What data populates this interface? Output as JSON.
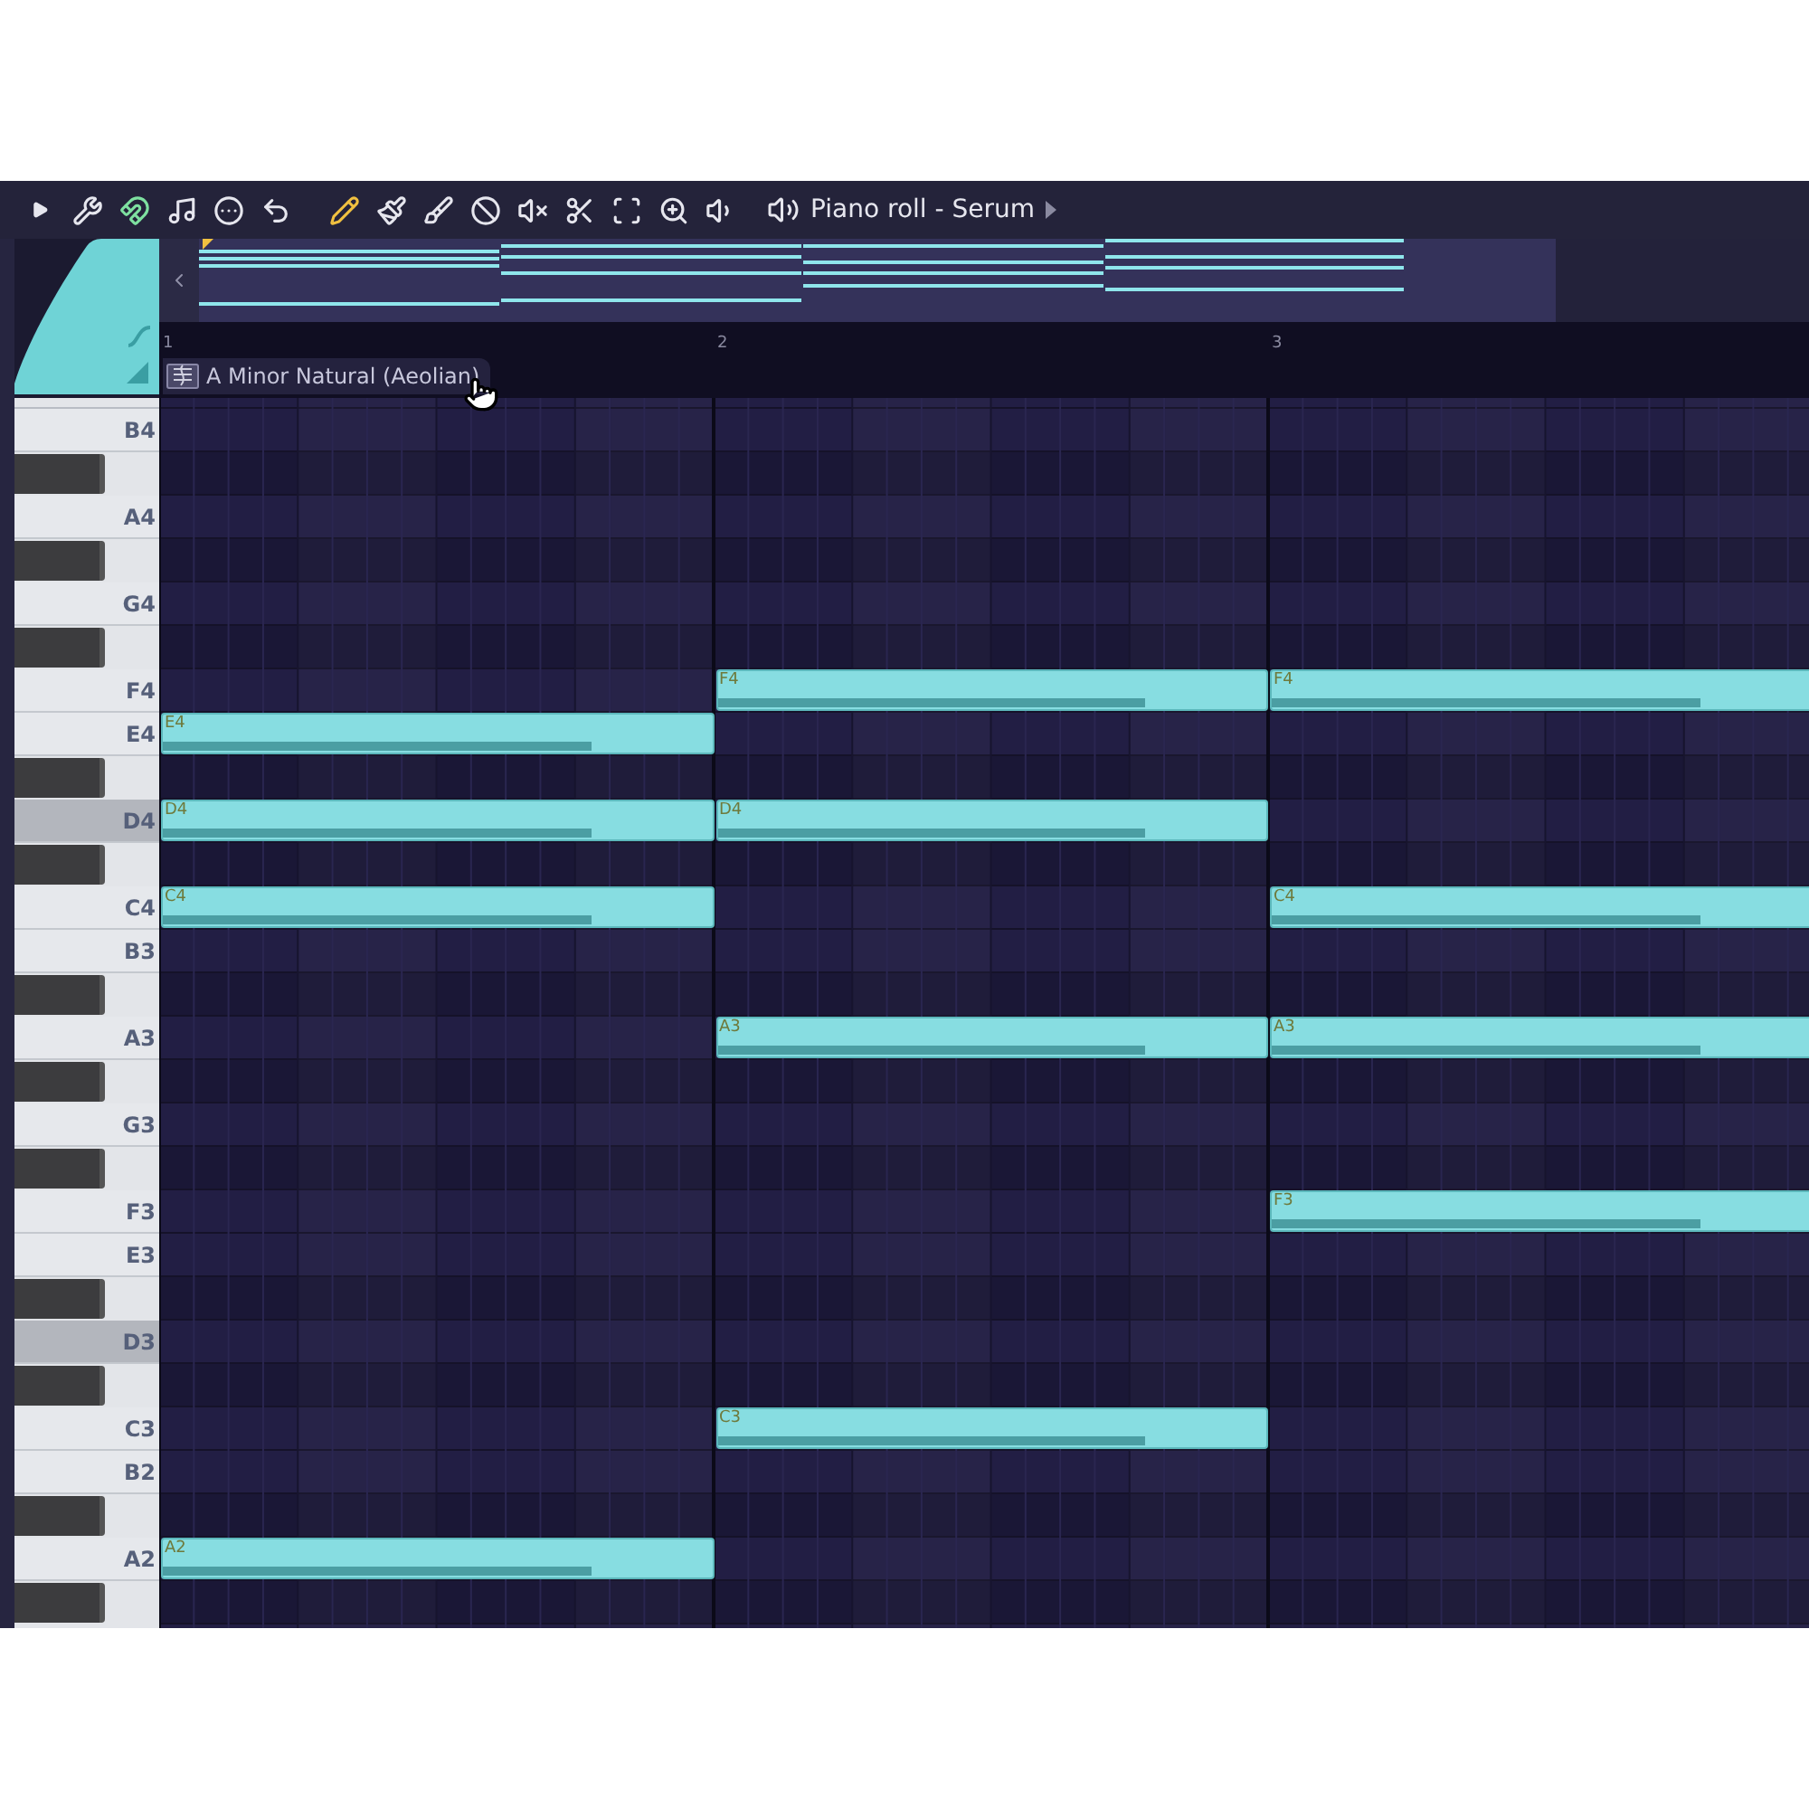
{
  "toolbar": {
    "tools": [
      {
        "kind": "play",
        "active": false
      },
      {
        "kind": "wrench",
        "active": false
      },
      {
        "kind": "magnet",
        "active": true
      },
      {
        "kind": "note",
        "active": false
      },
      {
        "kind": "menu",
        "active": false
      },
      {
        "kind": "undo",
        "active": false
      },
      {
        "kind": "pencil",
        "active": true
      },
      {
        "kind": "brush",
        "active": false
      },
      {
        "kind": "brush-plus",
        "active": false
      },
      {
        "kind": "ban",
        "active": false
      },
      {
        "kind": "mute",
        "active": false
      },
      {
        "kind": "slice",
        "active": false
      },
      {
        "kind": "select",
        "active": false
      },
      {
        "kind": "zoom",
        "active": false
      },
      {
        "kind": "playback",
        "active": false
      }
    ],
    "title": "Piano roll - Serum"
  },
  "ruler": {
    "bars": [
      {
        "label": "1"
      },
      {
        "label": "2"
      },
      {
        "label": "3"
      }
    ],
    "scale": "A Minor Natural (Aeolian)"
  },
  "keys": [
    {
      "kind": "white",
      "label": "B4",
      "highlighted": false
    },
    {
      "kind": "black",
      "highlighted": false
    },
    {
      "kind": "white",
      "label": "A4",
      "highlighted": false
    },
    {
      "kind": "black",
      "highlighted": false
    },
    {
      "kind": "white",
      "label": "G4",
      "highlighted": false
    },
    {
      "kind": "black",
      "highlighted": false
    },
    {
      "kind": "white",
      "label": "F4",
      "highlighted": false,
      "slots": [
        {
          "kind": "empty"
        },
        {
          "kind": "note",
          "label": "F4",
          "level": 0.78
        },
        {
          "kind": "note",
          "label": "F4",
          "level": 0.78
        }
      ]
    },
    {
      "kind": "white",
      "label": "E4",
      "highlighted": false,
      "slots": [
        {
          "kind": "note",
          "label": "E4",
          "level": 0.78
        }
      ]
    },
    {
      "kind": "black",
      "highlighted": false
    },
    {
      "kind": "white",
      "label": "D4",
      "highlighted": true,
      "slots": [
        {
          "kind": "note",
          "label": "D4",
          "level": 0.78
        },
        {
          "kind": "note",
          "label": "D4",
          "level": 0.78
        }
      ]
    },
    {
      "kind": "black",
      "highlighted": false
    },
    {
      "kind": "white",
      "label": "C4",
      "highlighted": false,
      "slots": [
        {
          "kind": "note",
          "label": "C4",
          "level": 0.78
        },
        {
          "kind": "empty"
        },
        {
          "kind": "note",
          "label": "C4",
          "level": 0.78
        }
      ]
    },
    {
      "kind": "white",
      "label": "B3",
      "highlighted": false
    },
    {
      "kind": "black",
      "highlighted": false
    },
    {
      "kind": "white",
      "label": "A3",
      "highlighted": false,
      "slots": [
        {
          "kind": "empty"
        },
        {
          "kind": "note",
          "label": "A3",
          "level": 0.78
        },
        {
          "kind": "note",
          "label": "A3",
          "level": 0.78
        }
      ]
    },
    {
      "kind": "black",
      "highlighted": false
    },
    {
      "kind": "white",
      "label": "G3",
      "highlighted": false
    },
    {
      "kind": "black",
      "highlighted": false
    },
    {
      "kind": "white",
      "label": "F3",
      "highlighted": false,
      "slots": [
        {
          "kind": "empty"
        },
        {
          "kind": "empty"
        },
        {
          "kind": "note",
          "label": "F3",
          "level": 0.78
        }
      ]
    },
    {
      "kind": "white",
      "label": "E3",
      "highlighted": false
    },
    {
      "kind": "black",
      "highlighted": false
    },
    {
      "kind": "white",
      "label": "D3",
      "highlighted": true
    },
    {
      "kind": "black",
      "highlighted": false
    },
    {
      "kind": "white",
      "label": "C3",
      "highlighted": false,
      "slots": [
        {
          "kind": "empty"
        },
        {
          "kind": "note",
          "label": "C3",
          "level": 0.78
        }
      ]
    },
    {
      "kind": "white",
      "label": "B2",
      "highlighted": false
    },
    {
      "kind": "black",
      "highlighted": false
    },
    {
      "kind": "white",
      "label": "A2",
      "highlighted": false,
      "slots": [
        {
          "kind": "note",
          "label": "A2",
          "level": 0.78
        }
      ]
    },
    {
      "kind": "black",
      "highlighted": false
    }
  ]
}
